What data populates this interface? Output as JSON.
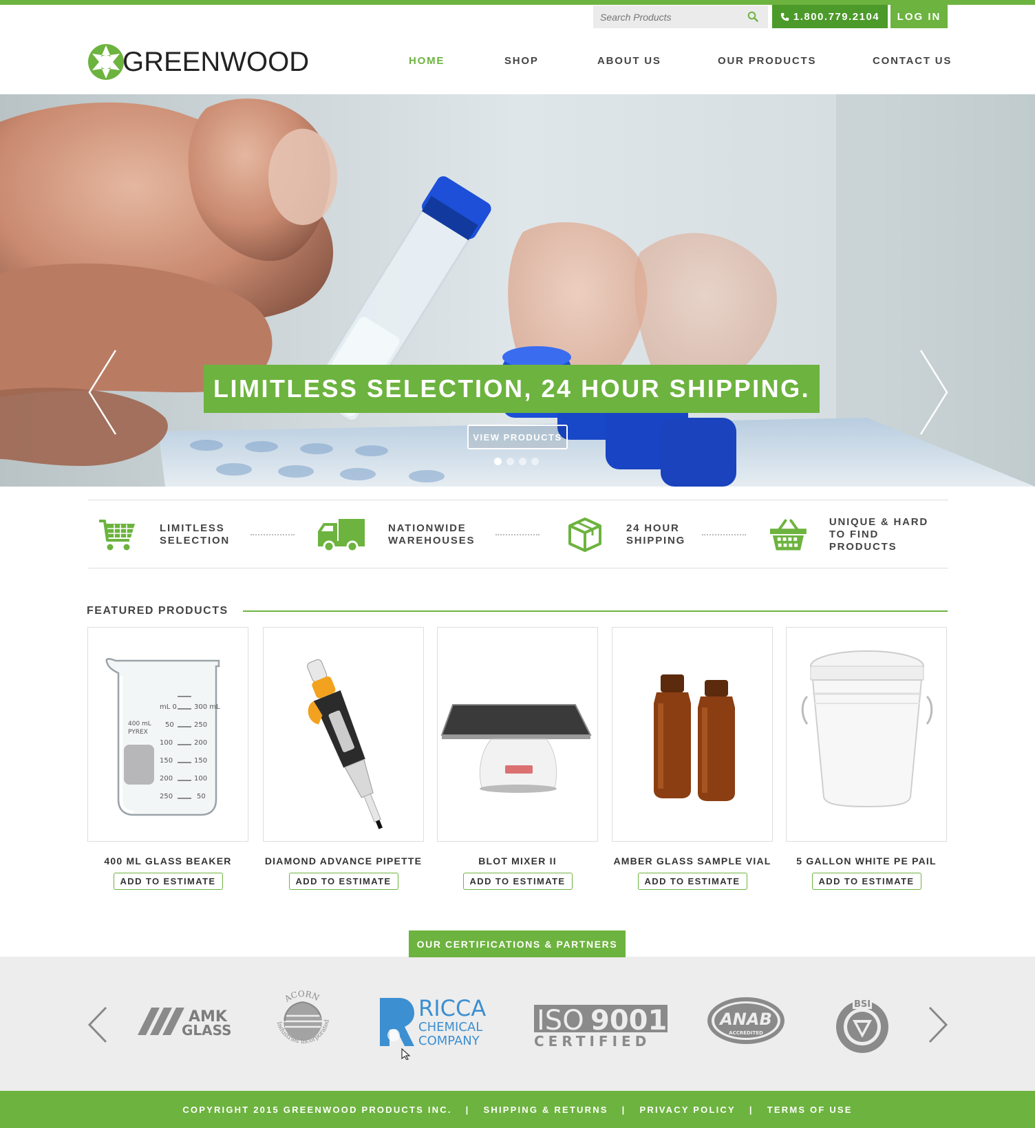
{
  "header": {
    "search_placeholder": "Search Products",
    "phone": "1.800.779.2104",
    "login": "LOG IN",
    "logo_text": "GREENWOOD"
  },
  "nav": {
    "items": [
      {
        "label": "HOME",
        "active": true
      },
      {
        "label": "SHOP",
        "active": false
      },
      {
        "label": "ABOUT US",
        "active": false
      },
      {
        "label": "OUR PRODUCTS",
        "active": false
      },
      {
        "label": "CONTACT US",
        "active": false
      }
    ]
  },
  "hero": {
    "title": "LIMITLESS SELECTION, 24 HOUR SHIPPING.",
    "cta": "VIEW PRODUCTS",
    "slides": 4,
    "active_slide": 1
  },
  "features": [
    {
      "label": "LIMITLESS\nSELECTION",
      "icon": "shopping-cart-icon"
    },
    {
      "label": "NATIONWIDE\nWAREHOUSES",
      "icon": "delivery-truck-icon"
    },
    {
      "label": "24 HOUR\nSHIPPING",
      "icon": "package-box-icon"
    },
    {
      "label": "UNIQUE & HARD\nTO FIND PRODUCTS",
      "icon": "shopping-basket-icon"
    }
  ],
  "featured": {
    "title": "FEATURED PRODUCTS",
    "button_label": "ADD TO ESTIMATE",
    "products": [
      {
        "name": "400 ML GLASS BEAKER"
      },
      {
        "name": "DIAMOND ADVANCE PIPETTE"
      },
      {
        "name": "BLOT MIXER II"
      },
      {
        "name": "AMBER GLASS SAMPLE VIAL"
      },
      {
        "name": "5 GALLON WHITE PE PAIL"
      }
    ]
  },
  "certifications": {
    "title": "OUR CERTIFICATIONS & PARTNERS",
    "logos": [
      {
        "name": "AMK Glass",
        "text": "AMK GLASS"
      },
      {
        "name": "Acorn Industries",
        "text": "ACORN Industries incorporated"
      },
      {
        "name": "Ricca Chemical Company",
        "text": "RICCA CHEMICAL COMPANY"
      },
      {
        "name": "ISO 9001 Certified",
        "text": "ISO9001 CERTIFIED"
      },
      {
        "name": "ANAB Accredited",
        "text": "ANAB ACCREDITED"
      },
      {
        "name": "BSI",
        "text": "BSI"
      }
    ]
  },
  "footer": {
    "items": [
      "COPYRIGHT 2015 GREENWOOD PRODUCTS INC.",
      "SHIPPING & RETURNS",
      "PRIVACY POLICY",
      "TERMS OF USE"
    ],
    "separator": "|"
  },
  "colors": {
    "brand_green": "#6db33f",
    "dark_green": "#4c9a2a",
    "text_dark": "#444444",
    "cert_band": "#ededed"
  }
}
